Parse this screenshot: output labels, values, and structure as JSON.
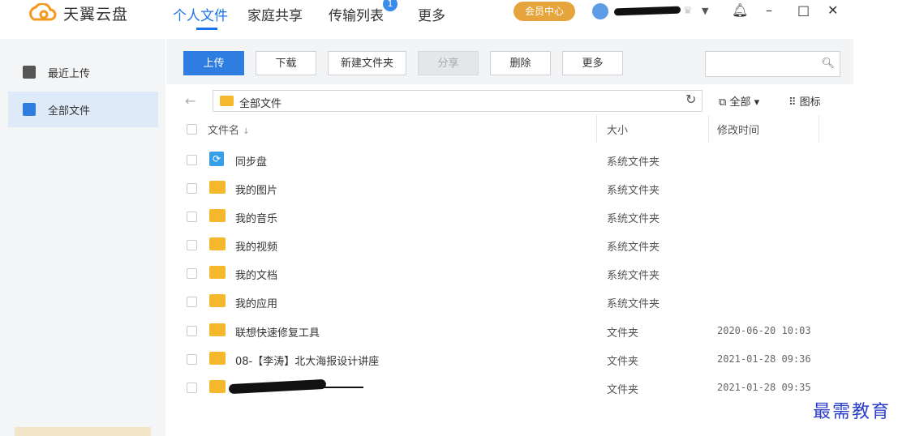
{
  "app": {
    "name": "天翼云盘",
    "nav": [
      "个人文件",
      "家庭共享",
      "传输列表",
      "更多"
    ],
    "transfer_badge": "1",
    "vip_label": "会员中心"
  },
  "sidebar": {
    "items": [
      {
        "label": "最近上传",
        "icon": "recent-upload-icon"
      },
      {
        "label": "全部文件",
        "icon": "all-files-icon",
        "active": true
      }
    ]
  },
  "toolbar": {
    "buttons": [
      "上传",
      "下载",
      "新建文件夹",
      "分享",
      "删除",
      "更多"
    ],
    "search_placeholder": ""
  },
  "pathbar": {
    "current": "全部文件",
    "view_filter": "全部",
    "view_mode": "图标"
  },
  "table": {
    "columns": {
      "name": "文件名",
      "sort_mark": "↓",
      "size": "大小",
      "modified": "修改时间"
    },
    "rows": [
      {
        "name": "同步盘",
        "size": "系统文件夹",
        "modified": "",
        "icon": "sync"
      },
      {
        "name": "我的图片",
        "size": "系统文件夹",
        "modified": ""
      },
      {
        "name": "我的音乐",
        "size": "系统文件夹",
        "modified": ""
      },
      {
        "name": "我的视频",
        "size": "系统文件夹",
        "modified": ""
      },
      {
        "name": "我的文档",
        "size": "系统文件夹",
        "modified": ""
      },
      {
        "name": "我的应用",
        "size": "系统文件夹",
        "modified": ""
      },
      {
        "name": "联想快速修复工具",
        "size": "文件夹",
        "modified": "2020-06-20 10:03"
      },
      {
        "name": "08-【李涛】北大海报设计讲座",
        "size": "文件夹",
        "modified": "2021-01-28 09:36"
      },
      {
        "name": "",
        "size": "文件夹",
        "modified": "2021-01-28 09:35",
        "redacted": true
      }
    ]
  },
  "watermark": "最需教育",
  "colors": {
    "accent": "#2d7ee0",
    "folder": "#f5b72b",
    "vip": "#e6a43c"
  }
}
